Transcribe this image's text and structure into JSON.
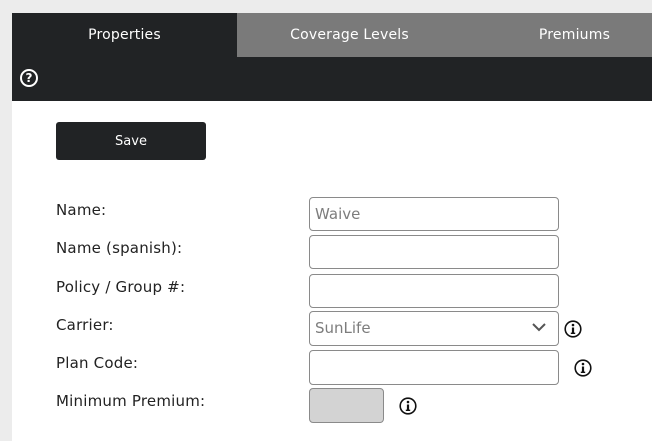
{
  "tabs": [
    {
      "label": "Properties",
      "active": true
    },
    {
      "label": "Coverage Levels",
      "active": false
    },
    {
      "label": "Premiums",
      "active": false
    }
  ],
  "toolbar": {
    "help_icon": "question-circle-icon"
  },
  "actions": {
    "save_label": "Save"
  },
  "form": {
    "name": {
      "label": "Name:",
      "placeholder": "Waive",
      "value": ""
    },
    "name_spanish": {
      "label": "Name (spanish):",
      "value": ""
    },
    "policy_group": {
      "label": "Policy / Group #:",
      "value": ""
    },
    "carrier": {
      "label": "Carrier:",
      "selected": "SunLife",
      "info_icon": "info-circle-icon"
    },
    "plan_code": {
      "label": "Plan Code:",
      "value": "",
      "info_icon": "info-circle-icon"
    },
    "minimum_premium": {
      "label": "Minimum Premium:",
      "value": "",
      "disabled": true,
      "info_icon": "info-circle-icon"
    }
  },
  "colors": {
    "tab_active_bg": "#212325",
    "tab_inactive_bg": "#7a7a7a",
    "toolbar_bg": "#212325",
    "button_bg": "#212325",
    "disabled_field_bg": "#d3d3d3"
  }
}
